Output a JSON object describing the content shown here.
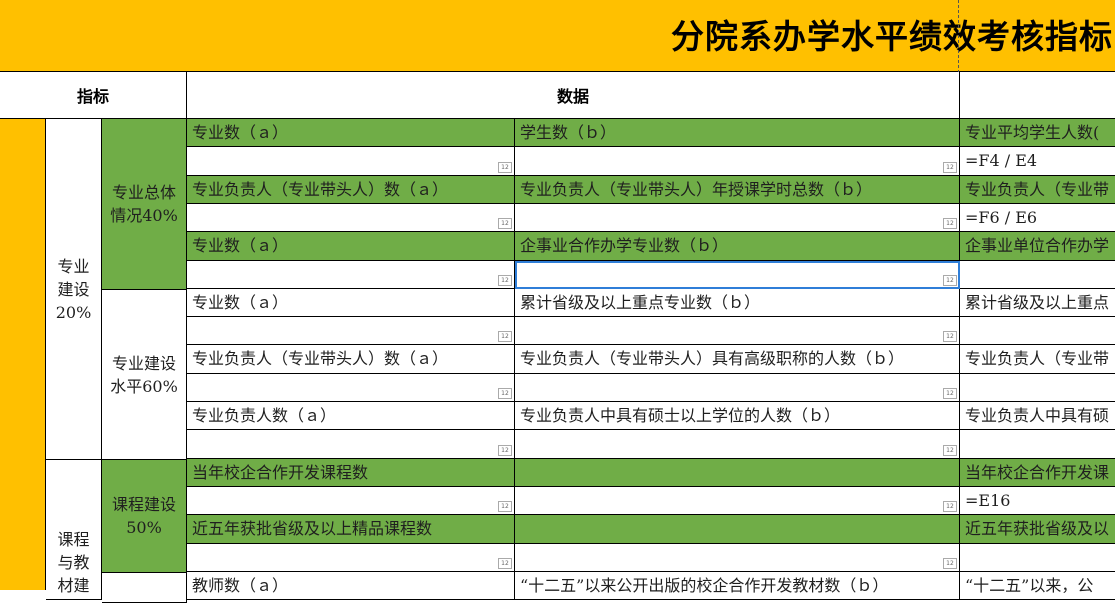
{
  "title": "分院系办学水平绩效考核指标",
  "headers": {
    "indicator": "指标",
    "data": "数据"
  },
  "primary": [
    {
      "label": "专业\n建设\n20%"
    },
    {
      "label": "课程\n与教\n材建"
    }
  ],
  "secondary": [
    {
      "label": "专业总体\n情况40%"
    },
    {
      "label": "专业建设\n水平60%"
    },
    {
      "label": "课程建设\n50%"
    }
  ],
  "rows": [
    {
      "a": "专业数（ａ）",
      "b": "学生数（ｂ）",
      "c": "专业平均学生人数("
    },
    {
      "a": "",
      "b": "",
      "c": "=F4 / E4"
    },
    {
      "a": "专业负责人（专业带头人）数（ａ）",
      "b": "专业负责人（专业带头人）年授课学时总数（ｂ）",
      "c": "专业负责人（专业带"
    },
    {
      "a": "",
      "b": "",
      "c": "=F6 / E6"
    },
    {
      "a": "专业数（ａ）",
      "b": "企事业合作办学专业数（ｂ）",
      "c": "企事业单位合作办学"
    },
    {
      "a": "",
      "b": "",
      "c": ""
    },
    {
      "a": "专业数（ａ）",
      "b": "累计省级及以上重点专业数（ｂ）",
      "c": "累计省级及以上重点"
    },
    {
      "a": "",
      "b": "",
      "c": ""
    },
    {
      "a": "专业负责人（专业带头人）数（ａ）",
      "b": "专业负责人（专业带头人）具有高级职称的人数（ｂ）",
      "c": "专业负责人（专业带"
    },
    {
      "a": "",
      "b": "",
      "c": ""
    },
    {
      "a": "专业负责人数（ａ）",
      "b": "专业负责人中具有硕士以上学位的人数（ｂ）",
      "c": "专业负责人中具有硕"
    },
    {
      "a": "",
      "b": "",
      "c": ""
    },
    {
      "a": "当年校企合作开发课程数",
      "b": "",
      "c": "当年校企合作开发课"
    },
    {
      "a": "",
      "b": "",
      "c": "=E16"
    },
    {
      "a": "近五年获批省级及以上精品课程数",
      "b": "",
      "c": "近五年获批省级及以"
    },
    {
      "a": "",
      "b": "",
      "c": ""
    },
    {
      "a": "教师数（ａ）",
      "b": "“十二五”以来公开出版的校企合作开发教材数（ｂ）",
      "c": "“十二五”以来，公"
    }
  ],
  "number_badge": "12",
  "colors": {
    "yellow": "#FFC000",
    "green": "#70AD47",
    "selection": "#2F7ED8"
  }
}
